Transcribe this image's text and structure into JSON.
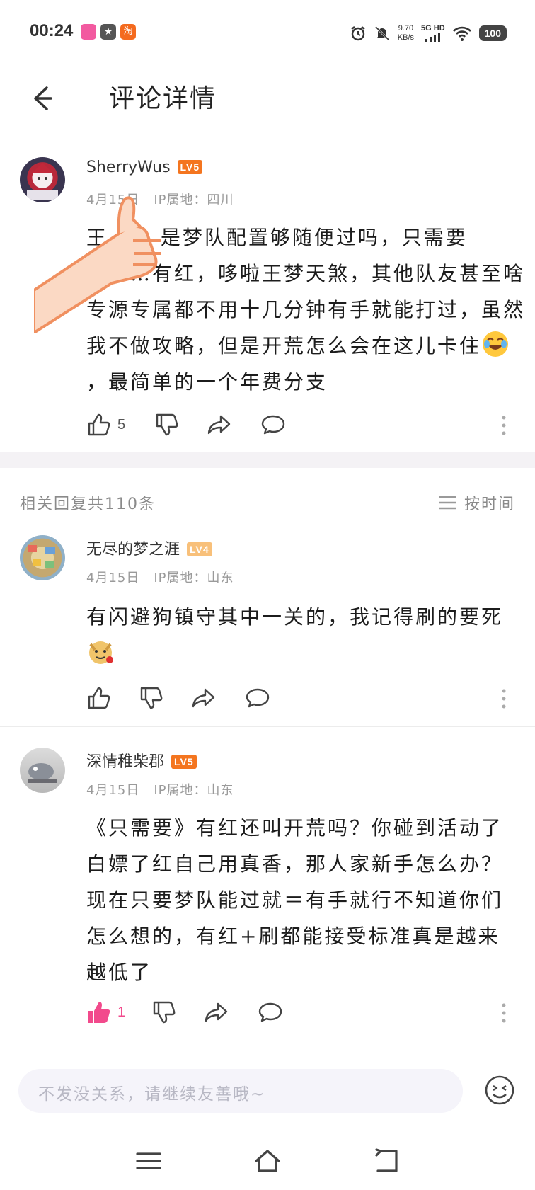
{
  "status_bar": {
    "time": "00:24",
    "speed_value": "9.70",
    "speed_unit": "KB/s",
    "network": "5G HD",
    "battery": "100",
    "icons": [
      "app-icon-pink",
      "app-icon-star",
      "app-icon-taobao",
      "alarm-icon",
      "mute-icon",
      "signal-icon",
      "wifi-icon",
      "battery-icon"
    ]
  },
  "header": {
    "title": "评论详情"
  },
  "main_comment": {
    "username": "SherryWus",
    "level": "LV5",
    "date": "4月15日",
    "ip": "IP属地：四川",
    "text_before_emoji": "王…… 是梦队配置够随便过吗，只需要暗……有红，哆啦王梦天煞，其他队友甚至啥专源专属都不用十几分钟有手就能打过，虽然我不做攻略，但是开荒怎么会在这儿卡住",
    "text_after_emoji": "，最简单的一个年费分支",
    "emoji": "laughing-crying-emoji",
    "likes": "5"
  },
  "replies_header": {
    "count_label": "相关回复共110条",
    "sort_label": "按时间"
  },
  "replies": [
    {
      "username": "无尽的梦之涯",
      "level": "LV4",
      "date": "4月15日",
      "ip": "IP属地：山东",
      "text_before_emoji": "有闪避狗镇守其中一关的，我记得刷的要死",
      "text_after_emoji": "",
      "emoji": "doge-rose-emoji",
      "likes": ""
    },
    {
      "username": "深情稚柴郡",
      "level": "LV5",
      "date": "4月15日",
      "ip": "IP属地：山东",
      "text_before_emoji": "《只需要》有红还叫开荒吗？你碰到活动了白嫖了红自己用真香，那人家新手怎么办？现在只要梦队能过就＝有手就行不知道你们怎么想的，有红+刷都能接受标准真是越来越低了",
      "text_after_emoji": "",
      "emoji": "",
      "likes": "1"
    }
  ],
  "input": {
    "placeholder": "不发没关系，请继续友善哦~"
  },
  "colors": {
    "level_orange": "#f4751f",
    "level_light": "#f8c07a",
    "like_pink": "#f24a8c",
    "divider": "#f4f2f5"
  }
}
